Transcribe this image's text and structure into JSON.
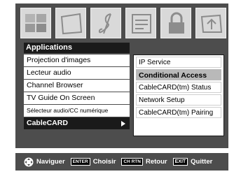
{
  "icons": [
    "picture-icon",
    "setup-icon",
    "audio-icon",
    "preferences-icon",
    "lock-icon",
    "applications-icon"
  ],
  "apps": {
    "title": "Applications",
    "items": [
      {
        "label": "Projection d'images"
      },
      {
        "label": "Lecteur audio"
      },
      {
        "label": "Channel Browser"
      },
      {
        "label": "TV Guide On Screen"
      },
      {
        "label": "Sélecteur audio/CC numérique"
      },
      {
        "label": "CableCARD"
      }
    ]
  },
  "submenu": {
    "items": [
      {
        "label": "IP Service"
      },
      {
        "label": "Conditional Access"
      },
      {
        "label": "CableCARD(tm) Status"
      },
      {
        "label": "Network Setup"
      },
      {
        "label": "CableCARD(tm) Pairing"
      }
    ]
  },
  "footer": {
    "nav_label": "Naviguer",
    "enter_key": "ENTER",
    "enter_label": "Choisir",
    "rtn_key": "CH RTN",
    "rtn_label": "Retour",
    "exit_key": "EXIT",
    "exit_label": "Quitter"
  },
  "colors": {
    "panel": "#4d4d4d",
    "selected": "#1a1a1a",
    "highlight": "#b9b9b9"
  }
}
